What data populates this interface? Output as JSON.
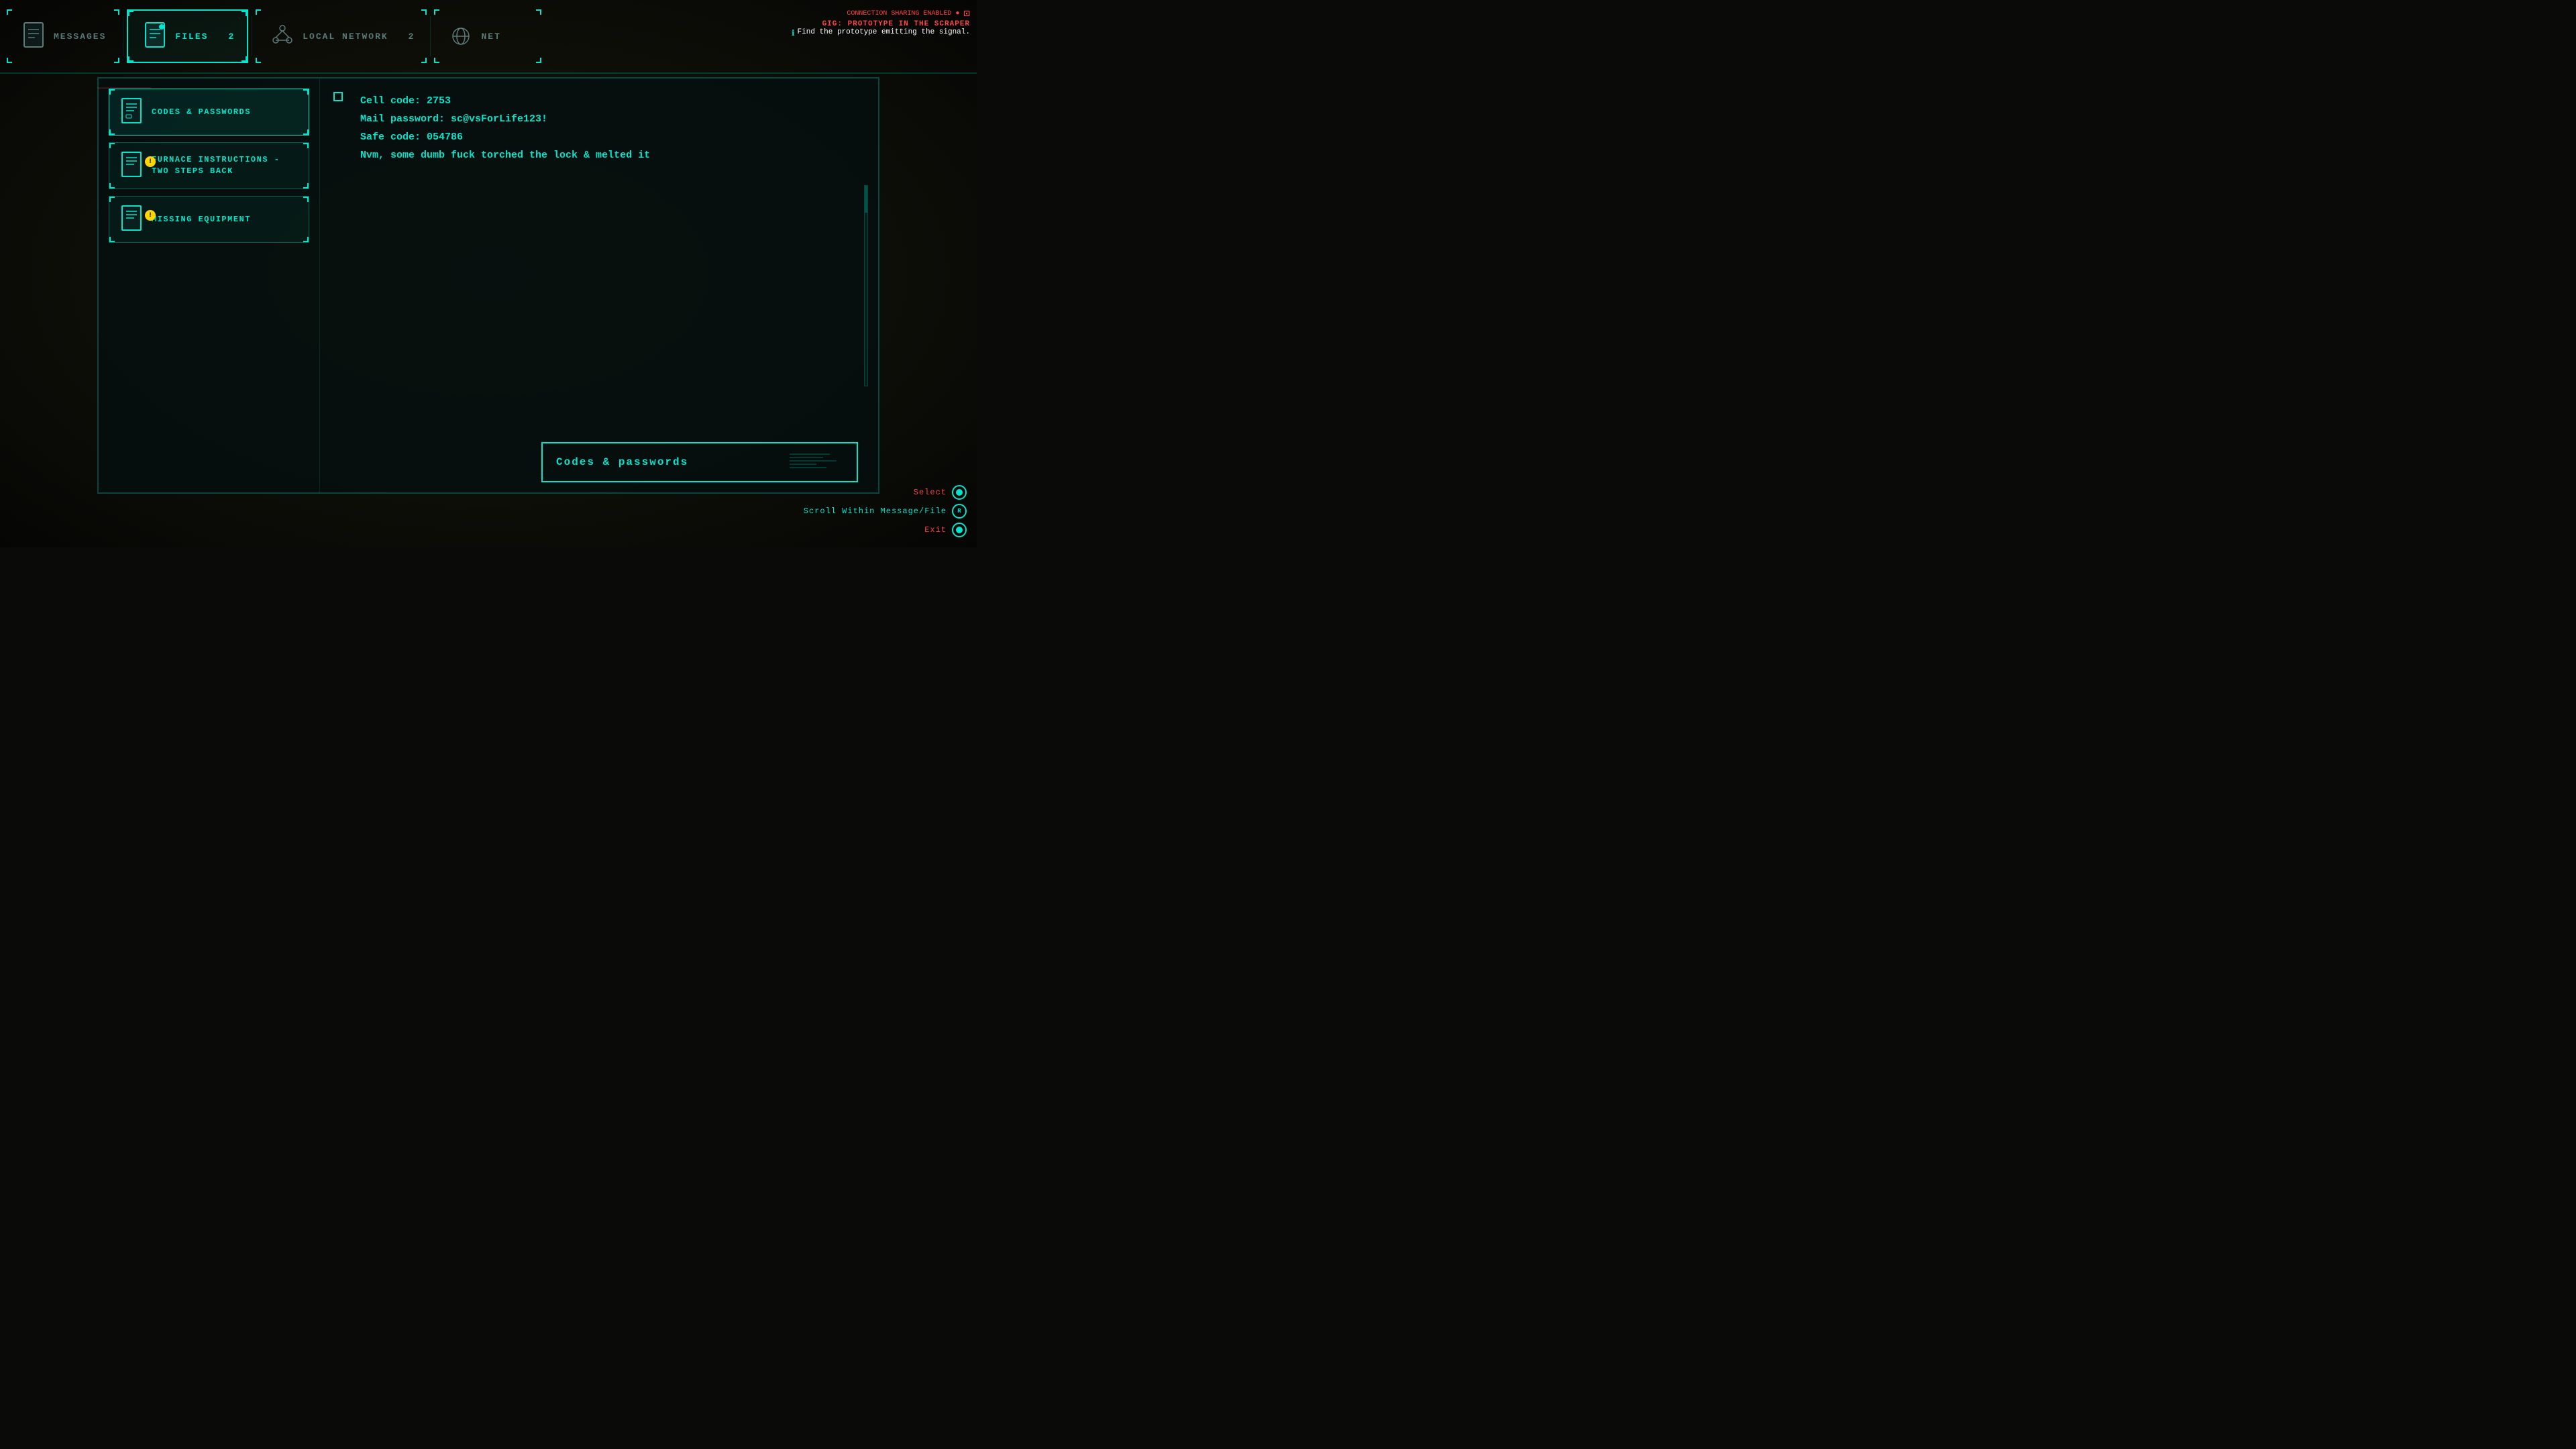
{
  "nav": {
    "tabs": [
      {
        "id": "messages",
        "label": "MESSAGES",
        "count": null,
        "active": false
      },
      {
        "id": "files",
        "label": "FILES",
        "count": "2",
        "active": true
      },
      {
        "id": "local_network",
        "label": "LOCAL NETWORK",
        "count": "2",
        "active": false
      },
      {
        "id": "net",
        "label": "NET",
        "count": null,
        "active": false
      }
    ]
  },
  "gig": {
    "title": "GIG: PROTOTYPE IN THE SCRAPER",
    "objective": "Find the prototype emitting the signal."
  },
  "sidebar": {
    "items": [
      {
        "id": "codes_passwords",
        "label": "CODES & PASSWORDS",
        "alert": false,
        "active": true
      },
      {
        "id": "furnace_instructions",
        "label": "FURNACE INSTRUCTIONS - TWO STEPS BACK",
        "alert": true,
        "active": false
      },
      {
        "id": "missing_equipment",
        "label": "MISSING EQUIPMENT",
        "alert": true,
        "active": false
      }
    ]
  },
  "file": {
    "content_lines": [
      "Cell code: 2753",
      "Mail password: sc@vsForLife123!",
      "Safe code: 054786",
      "Nvm, some dumb fuck torched the lock & melted it"
    ],
    "title": "Codes & passwords"
  },
  "controls": [
    {
      "label": "Select",
      "button": "○"
    },
    {
      "label": "Scroll Within Message/File",
      "button": "R"
    },
    {
      "label": "Exit",
      "button": "○"
    }
  ]
}
